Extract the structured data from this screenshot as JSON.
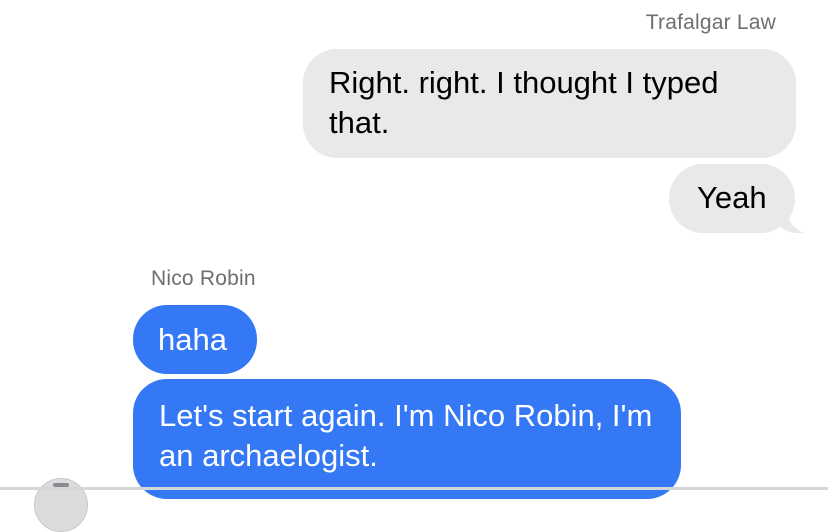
{
  "conversation": {
    "participants": {
      "trafalgar_law": "Trafalgar Law",
      "nico_robin": "Nico Robin"
    },
    "messages": [
      {
        "text": "Right. right. I thought I typed that.",
        "direction": "incoming"
      },
      {
        "text": "Yeah",
        "direction": "incoming"
      },
      {
        "text": "haha",
        "direction": "outgoing"
      },
      {
        "text": "Let's start again. I'm Nico Robin, I'm an archaelogist.",
        "direction": "outgoing"
      }
    ]
  },
  "colors": {
    "incoming_bubble": "#e9e9eb",
    "outgoing_bubble": "#3478f6",
    "sender_label": "#6e6e73"
  },
  "icons": {
    "avatar": "avatar-icon"
  }
}
